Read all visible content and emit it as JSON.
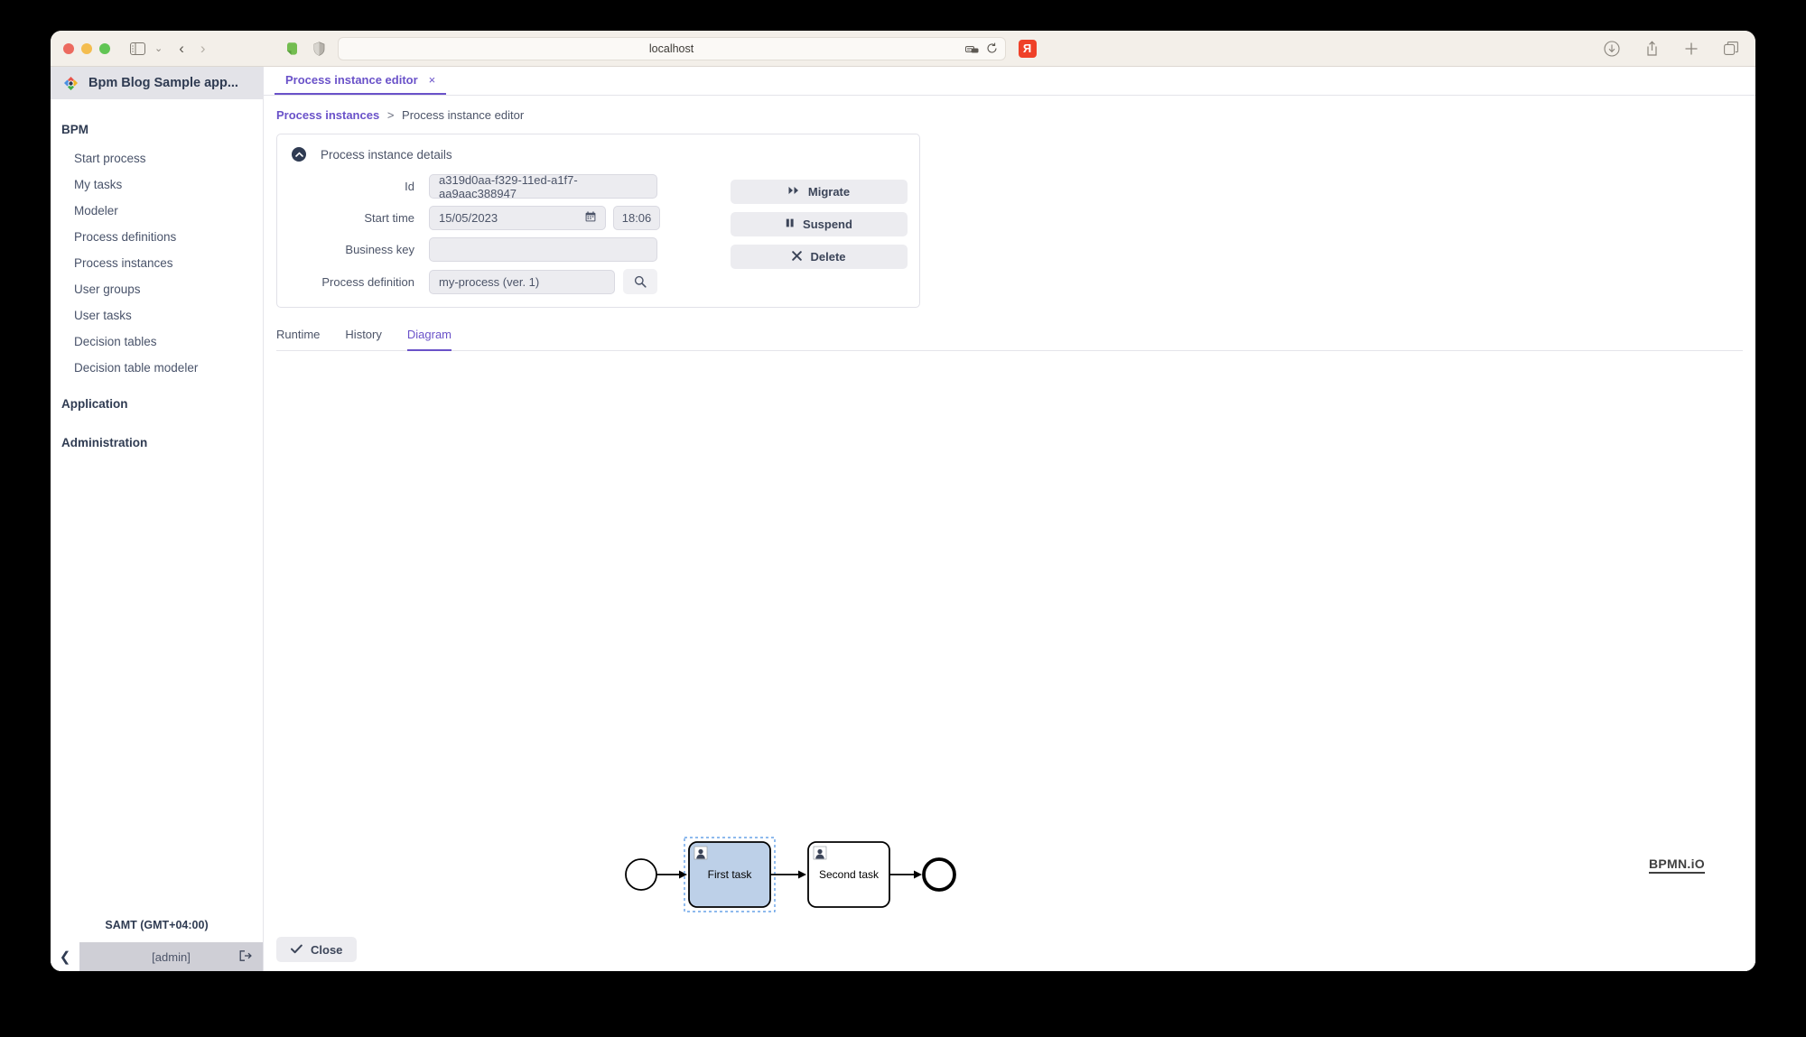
{
  "browser": {
    "url": "localhost",
    "icons": {
      "sidebar_toggle": "sidebar-toggle-icon",
      "tab_chevron": "chevron-down-icon",
      "back": "back-arrow-icon",
      "forward": "forward-arrow-icon",
      "evernote": "evernote-extension-icon",
      "shield": "shield-extension-icon",
      "reader": "reader-view-icon",
      "reload": "reload-icon",
      "yandex": "yandex-extension-icon",
      "download": "download-icon",
      "share": "share-icon",
      "new_tab": "plus-icon",
      "tab_overview": "tab-overview-icon"
    },
    "yandex_label": "Я"
  },
  "app": {
    "brand_title": "Bpm Blog Sample app...",
    "brand_icon": "diamond-logo-icon"
  },
  "sidebar": {
    "groups": [
      {
        "title": "BPM",
        "items": [
          "Start process",
          "My tasks",
          "Modeler",
          "Process definitions",
          "Process instances",
          "User groups",
          "User tasks",
          "Decision tables",
          "Decision table modeler"
        ]
      },
      {
        "title": "Application",
        "items": []
      },
      {
        "title": "Administration",
        "items": []
      }
    ],
    "timezone": "SAMT (GMT+04:00)",
    "user": "[admin]",
    "collapse_icon": "chevron-left-icon",
    "logout_icon": "logout-icon"
  },
  "tabs": {
    "open": [
      {
        "label": "Process instance editor",
        "close": "×",
        "active": true
      }
    ]
  },
  "breadcrumb": {
    "root": "Process instances",
    "separator": ">",
    "current": "Process instance editor"
  },
  "details": {
    "title": "Process instance details",
    "collapse_icon": "chevron-up-circle-icon",
    "fields": {
      "id": {
        "label": "Id",
        "value": "a319d0aa-f329-11ed-a1f7-aa9aac388947"
      },
      "start_time": {
        "label": "Start time",
        "date": "15/05/2023",
        "time": "18:06",
        "calendar_icon": "calendar-icon"
      },
      "business_key": {
        "label": "Business key",
        "value": ""
      },
      "process_definition": {
        "label": "Process definition",
        "value": "my-process (ver. 1)",
        "search_icon": "search-icon"
      }
    },
    "actions": [
      {
        "label": "Migrate",
        "icon": "fast-forward-icon",
        "glyph": "▶▶"
      },
      {
        "label": "Suspend",
        "icon": "pause-icon",
        "glyph": "❚❚"
      },
      {
        "label": "Delete",
        "icon": "close-x-icon",
        "glyph": "✖"
      }
    ]
  },
  "content_tabs": [
    {
      "label": "Runtime",
      "active": false
    },
    {
      "label": "History",
      "active": false
    },
    {
      "label": "Diagram",
      "active": true
    }
  ],
  "diagram": {
    "watermark": "BPMN.iO",
    "nodes": [
      {
        "type": "start-event",
        "label": ""
      },
      {
        "type": "user-task",
        "label": "First task",
        "selected": true,
        "highlighted": true
      },
      {
        "type": "user-task",
        "label": "Second task",
        "selected": false,
        "highlighted": false
      },
      {
        "type": "end-event",
        "label": ""
      }
    ]
  },
  "footer": {
    "close_label": "Close",
    "close_icon": "check-icon"
  },
  "colors": {
    "accent": "#6a52c9",
    "task_highlight": "#bdd0e8",
    "selection": "#4a90e2",
    "sidebar_header": "#e3e3e8",
    "field_bg": "#ececf0"
  }
}
